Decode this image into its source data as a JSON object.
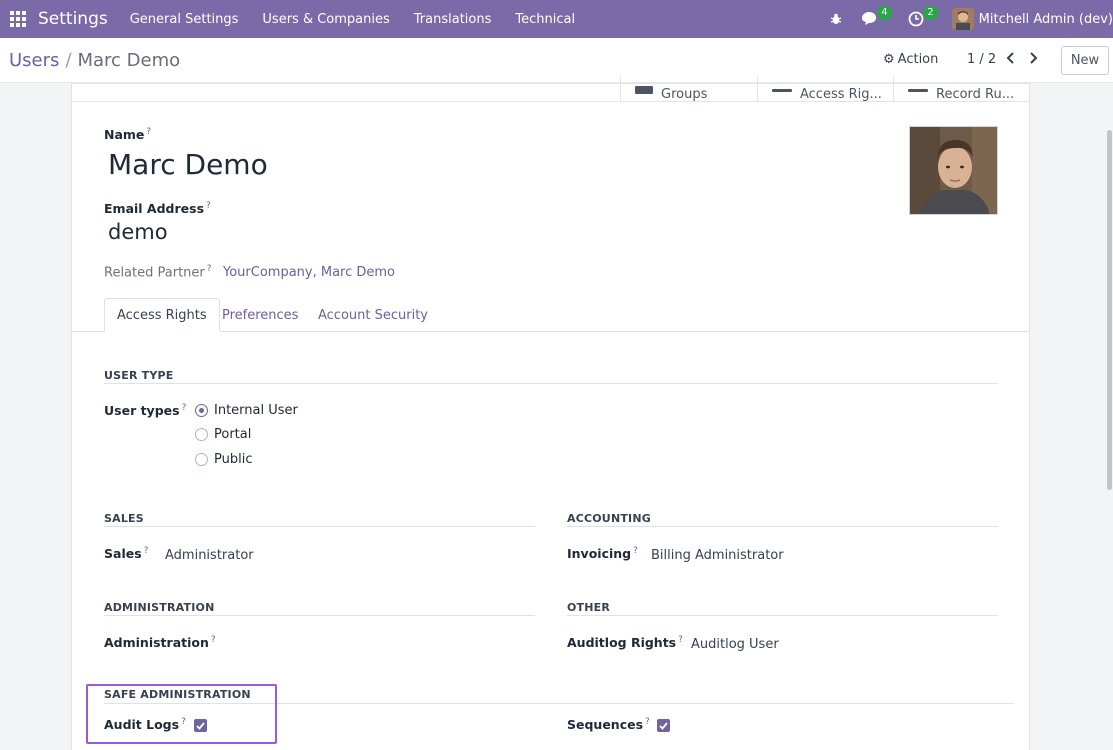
{
  "navbar": {
    "brand": "Settings",
    "menu": [
      "General Settings",
      "Users & Companies",
      "Translations",
      "Technical"
    ],
    "messages_count": "4",
    "activities_count": "2",
    "user_name": "Mitchell Admin (dev)"
  },
  "control_panel": {
    "breadcrumb_parent": "Users",
    "breadcrumb_separator": "/",
    "breadcrumb_current": "Marc Demo",
    "action_label": "Action",
    "pager": "1 / 2",
    "new_label": "New"
  },
  "smart_buttons": [
    "Groups",
    "Access Rig...",
    "Record Ru..."
  ],
  "form": {
    "name_label": "Name",
    "name_value": "Marc Demo",
    "email_label": "Email Address",
    "email_value": "demo",
    "partner_label": "Related Partner",
    "partner_value": "YourCompany, Marc Demo",
    "help_mark": "?"
  },
  "tabs": [
    "Access Rights",
    "Preferences",
    "Account Security"
  ],
  "sections": {
    "user_type": {
      "title": "USER TYPE",
      "label": "User types",
      "options": [
        "Internal User",
        "Portal",
        "Public"
      ],
      "selected": "Internal User"
    },
    "sales": {
      "title": "SALES",
      "label": "Sales",
      "value": "Administrator"
    },
    "accounting": {
      "title": "ACCOUNTING",
      "label": "Invoicing",
      "value": "Billing Administrator"
    },
    "administration": {
      "title": "ADMINISTRATION",
      "label": "Administration",
      "value": ""
    },
    "other": {
      "title": "OTHER",
      "label": "Auditlog Rights",
      "value": "Auditlog User"
    },
    "safe_administration": {
      "title": "SAFE ADMINISTRATION",
      "audit_logs_label": "Audit Logs",
      "audit_logs_checked": true,
      "sequences_label": "Sequences",
      "sequences_checked": true
    }
  },
  "colors": {
    "navbar": "#7b6aa8",
    "link": "#6f5da3",
    "checkbox": "#71639e",
    "badge": "#28a745",
    "highlight": "#9b59e0"
  }
}
